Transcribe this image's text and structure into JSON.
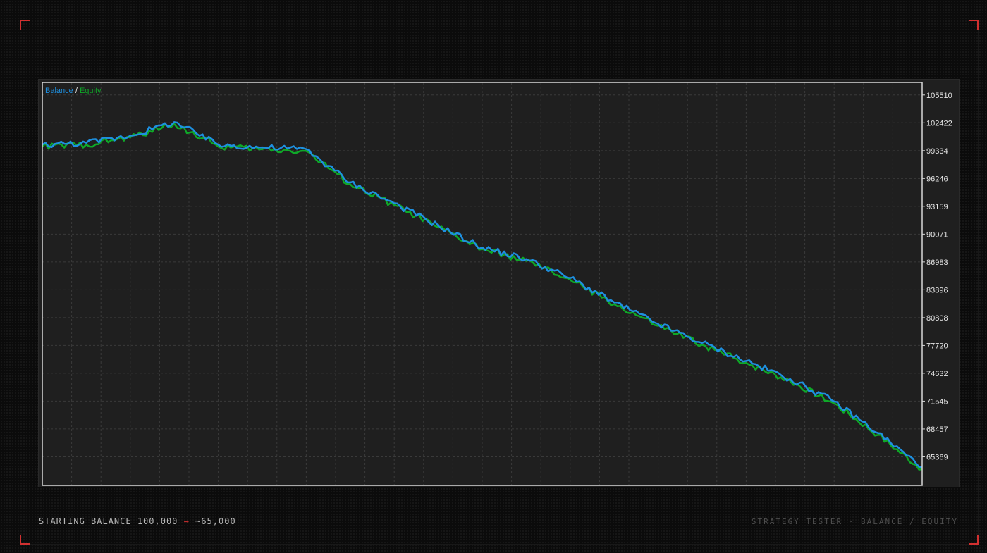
{
  "footer": {
    "start_label": "STARTING BALANCE",
    "start_value": "100,000",
    "arrow": "→",
    "end_value": "~65,000",
    "right_caption": "STRATEGY TESTER · BALANCE / EQUITY"
  },
  "colors": {
    "accent_red": "#d23030",
    "balance_blue": "#1e90e0",
    "equity_green": "#0fa828",
    "chart_bg": "#1f1f1f",
    "axis_text": "#e6e6e6"
  },
  "chart_data": {
    "type": "line",
    "legend": {
      "placement": "top-left",
      "separator": " / "
    },
    "x": [
      0,
      5,
      10,
      15,
      20,
      25,
      30,
      35,
      40,
      45,
      50,
      55,
      60,
      65,
      70,
      75,
      80,
      85,
      90,
      95,
      100
    ],
    "series": [
      {
        "name": "Balance",
        "color": "#1e90e0",
        "values": [
          100000,
          100200,
          101000,
          102500,
          100000,
          99700,
          99500,
          95800,
          93500,
          91000,
          88600,
          87300,
          85200,
          82500,
          80100,
          78000,
          76000,
          74000,
          71500,
          68000,
          64200
        ]
      },
      {
        "name": "Equity",
        "color": "#0fa828",
        "values": [
          99800,
          100000,
          100800,
          102300,
          99800,
          99500,
          99300,
          95600,
          93300,
          90800,
          88400,
          87100,
          85000,
          82300,
          79900,
          77800,
          75800,
          73800,
          71300,
          67800,
          64000
        ]
      }
    ],
    "y_ticks": [
      105510,
      102422,
      99334,
      96246,
      93159,
      90071,
      86983,
      83896,
      80808,
      77720,
      74632,
      71545,
      68457,
      65369
    ],
    "ylim": [
      62200,
      106900
    ],
    "grid": true,
    "y_axis_side": "right"
  }
}
